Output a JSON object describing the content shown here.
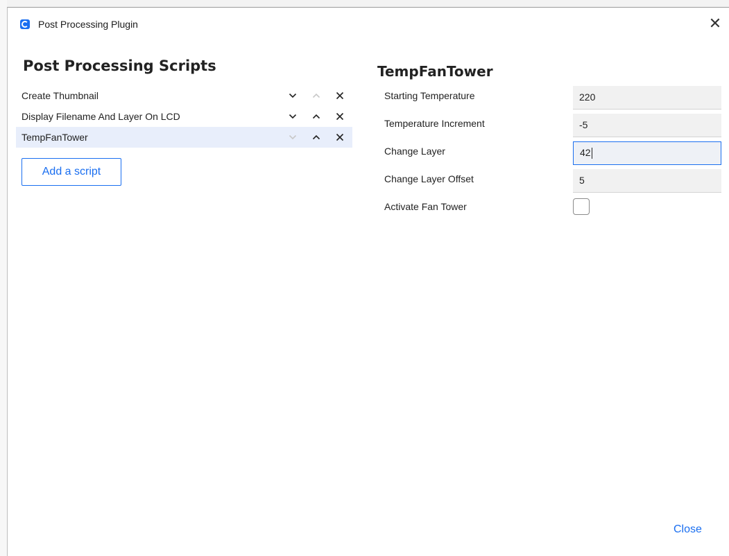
{
  "window": {
    "title": "Post Processing Plugin",
    "close_glyph": "✕",
    "accent_color": "#196ef0"
  },
  "scripts_panel": {
    "heading": "Post Processing Scripts",
    "items": [
      {
        "label": "Create Thumbnail",
        "move_down_enabled": true,
        "move_up_enabled": false,
        "selected": false
      },
      {
        "label": "Display Filename And Layer On LCD",
        "move_down_enabled": true,
        "move_up_enabled": true,
        "selected": false
      },
      {
        "label": "TempFanTower",
        "move_down_enabled": false,
        "move_up_enabled": true,
        "selected": true
      }
    ],
    "add_button_label": "Add a script"
  },
  "settings_panel": {
    "heading": "TempFanTower",
    "fields": [
      {
        "label": "Starting Temperature",
        "value": "220",
        "focused": false
      },
      {
        "label": "Temperature Increment",
        "value": "-5",
        "focused": false
      },
      {
        "label": "Change Layer",
        "value": "42",
        "focused": true
      },
      {
        "label": "Change Layer Offset",
        "value": "5",
        "focused": false
      }
    ],
    "checkbox": {
      "label": "Activate Fan Tower",
      "checked": false
    }
  },
  "footer": {
    "close_label": "Close"
  }
}
